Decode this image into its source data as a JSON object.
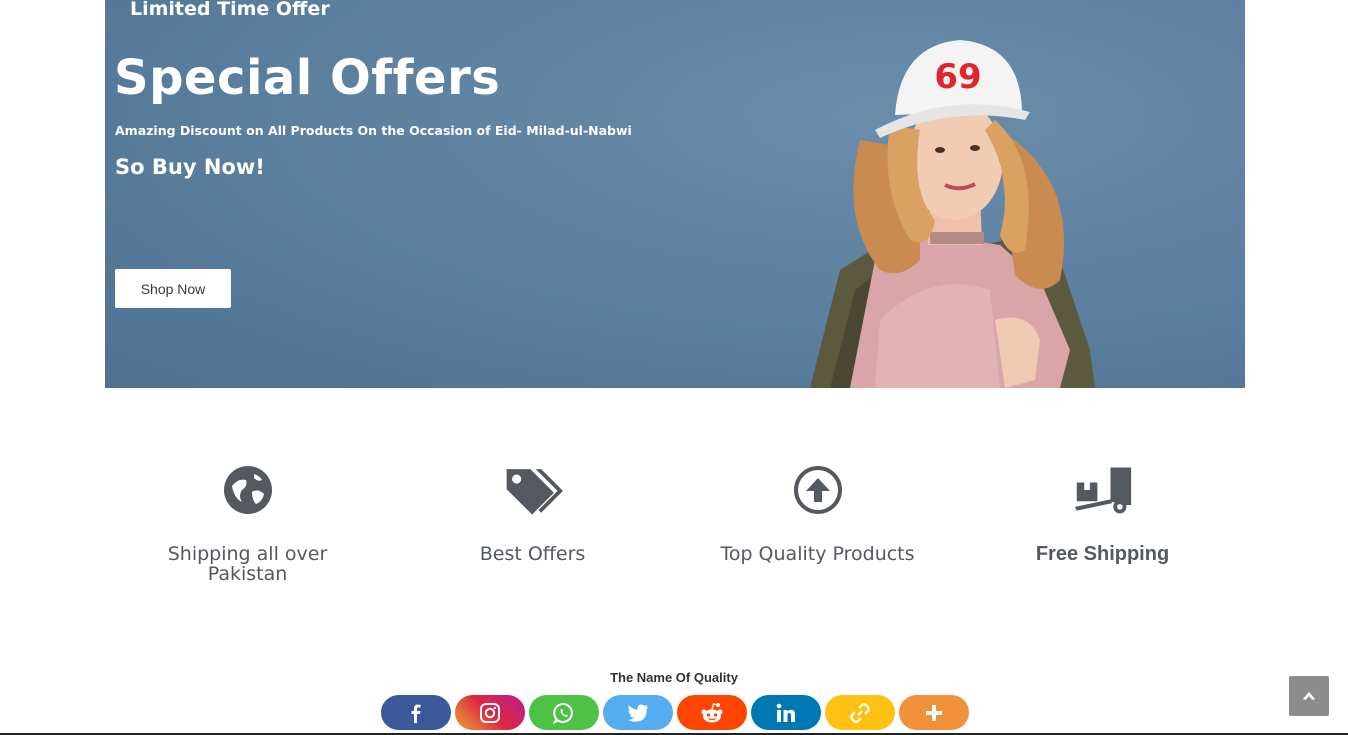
{
  "hero": {
    "eyebrow": "Limited Time Offer",
    "title": "Special Offers",
    "subtitle": "Amazing Discount on All Products On the Occasion of Eid- Milad-ul-Nabwi",
    "cta_text": "So Buy Now!",
    "button_label": "Shop Now",
    "cap_number": "69",
    "background_color": "#5b7f9e"
  },
  "features": [
    {
      "icon": "globe-icon",
      "label": "Shipping all over Pakistan"
    },
    {
      "icon": "tags-icon",
      "label": "Best Offers"
    },
    {
      "icon": "arrow-up-circle-icon",
      "label": "Top Quality Products"
    },
    {
      "icon": "dolly-icon",
      "label": "Free Shipping"
    }
  ],
  "footer": {
    "tagline": "The Name Of Quality",
    "share_buttons": [
      {
        "name": "facebook",
        "icon": "facebook-icon",
        "color": "#3b5998"
      },
      {
        "name": "instagram",
        "icon": "instagram-icon",
        "color": "#e1306c"
      },
      {
        "name": "whatsapp",
        "icon": "whatsapp-icon",
        "color": "#4dc247"
      },
      {
        "name": "twitter",
        "icon": "twitter-icon",
        "color": "#55acee"
      },
      {
        "name": "reddit",
        "icon": "reddit-icon",
        "color": "#ff4500"
      },
      {
        "name": "linkedin",
        "icon": "linkedin-icon",
        "color": "#0077b5"
      },
      {
        "name": "copy-link",
        "icon": "link-icon",
        "color": "#ffc112"
      },
      {
        "name": "more",
        "icon": "plus-icon",
        "color": "#f1913c"
      }
    ]
  },
  "colors": {
    "icon_gray": "#54595f",
    "scroll_top": "#8c8c8c"
  }
}
